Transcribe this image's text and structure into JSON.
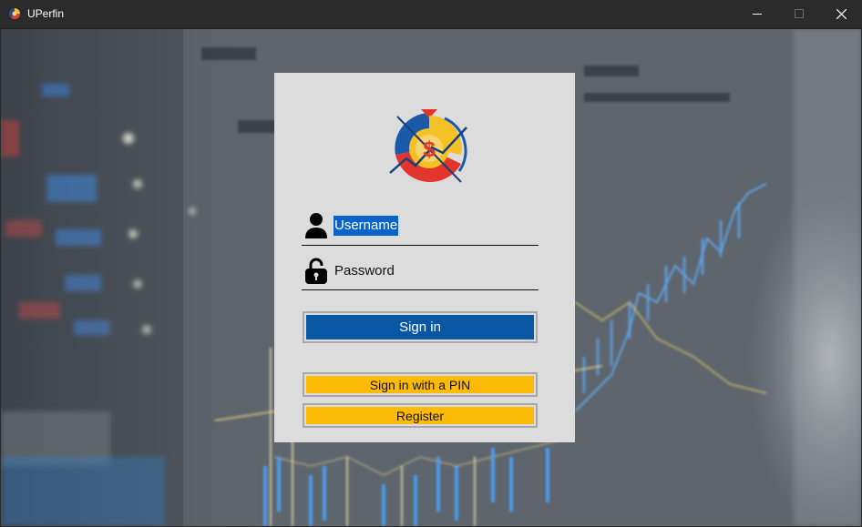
{
  "window": {
    "title": "UPerfin",
    "icon": "app-logo-icon",
    "controls": [
      "minimize-icon",
      "maximize-icon",
      "close-icon"
    ]
  },
  "background": {
    "description_icon": "stock-chart-background",
    "ticker_texts": [
      "GBPUSD",
      "DE30",
      "GBPUSD",
      "Follow grid"
    ]
  },
  "login": {
    "logo": "uperfin-logo",
    "username": {
      "icon": "user-icon",
      "value": "Username"
    },
    "password": {
      "icon": "unlock-icon",
      "placeholder": "Password"
    },
    "signin_label": "Sign in",
    "pin_label": "Sign in with a PIN",
    "register_label": "Register"
  },
  "colors": {
    "primary": "#0757a5",
    "accent": "#fdbb07",
    "panel": "#dcdcdc",
    "selection": "#0a64c8"
  }
}
